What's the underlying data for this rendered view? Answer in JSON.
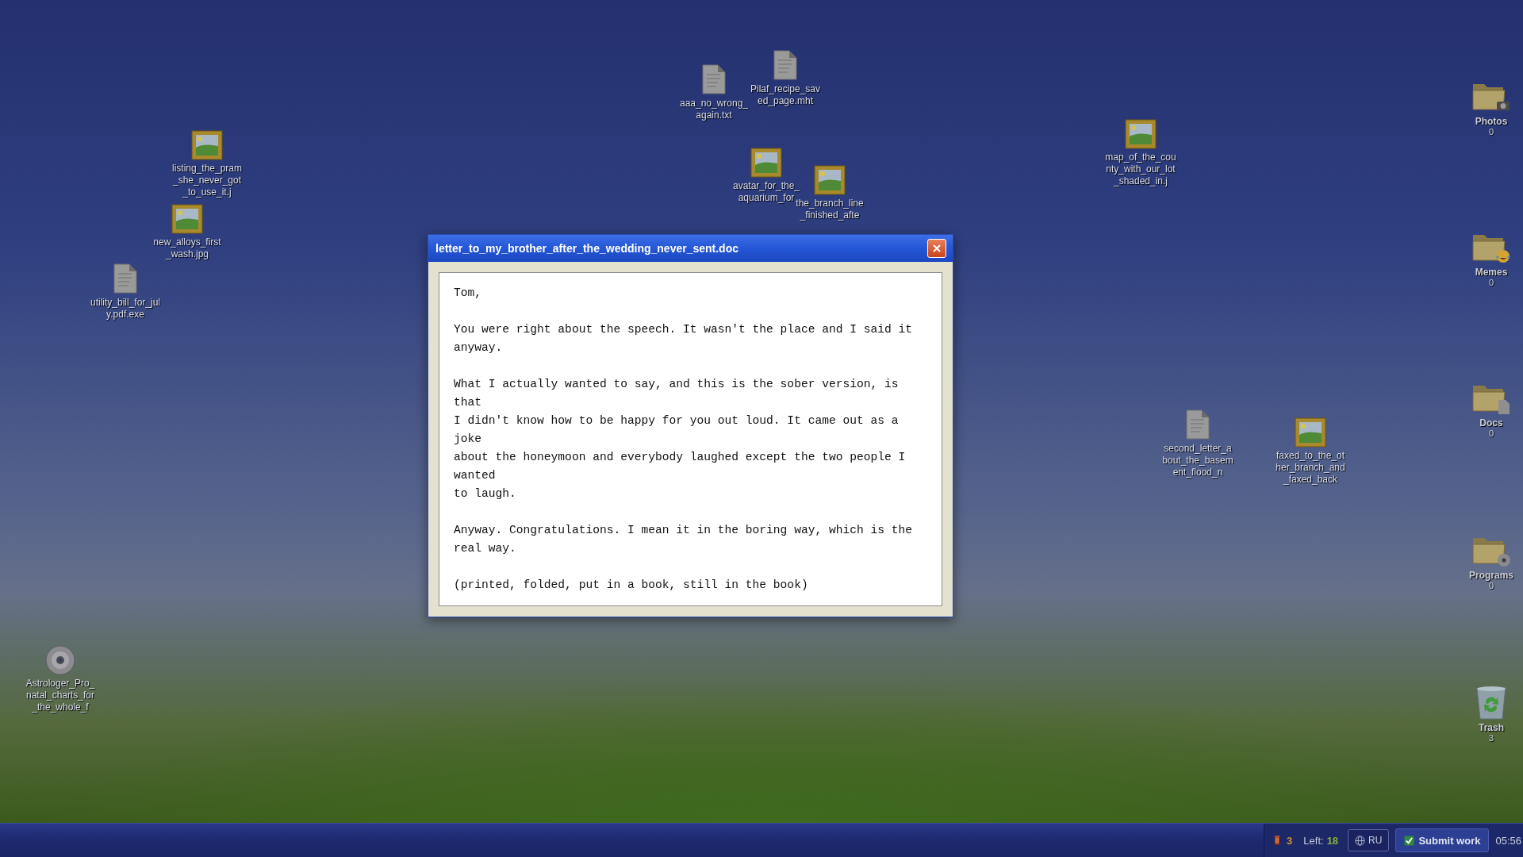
{
  "desktop": {
    "icons": [
      {
        "kind": "image",
        "label": "listing_the_pram_she_never_got_to_use_it.j"
      },
      {
        "kind": "image",
        "label": "new_alloys_first_wash.jpg"
      },
      {
        "kind": "document",
        "label": "utility_bill_for_july.pdf.exe"
      },
      {
        "kind": "disc",
        "label": "Astrologer_Pro_natal_charts_for_the_whole_f"
      },
      {
        "kind": "document",
        "label": "Pilaf_recipe_saved_page.mht"
      },
      {
        "kind": "document",
        "label": "aaa_no_wrong_again.txt"
      },
      {
        "kind": "image",
        "label": "avatar_for_the_aquarium_for"
      },
      {
        "kind": "image",
        "label": "the_branch_line_finished_afte"
      },
      {
        "kind": "image",
        "label": "map_of_the_county_with_our_lot_shaded_in.j"
      },
      {
        "kind": "document",
        "label": "second_letter_about_the_basement_flood_n"
      },
      {
        "kind": "image",
        "label": "faxed_to_the_other_branch_and_faxed_back"
      }
    ],
    "folders": [
      {
        "kind": "photos",
        "label": "Photos",
        "count": "0"
      },
      {
        "kind": "memes",
        "label": "Memes",
        "count": "0"
      },
      {
        "kind": "docs",
        "label": "Docs",
        "count": "0"
      },
      {
        "kind": "programs",
        "label": "Programs",
        "count": "0"
      },
      {
        "kind": "trash",
        "label": "Trash",
        "count": "3"
      }
    ]
  },
  "dialog": {
    "title": "letter_to_my_brother_after_the_wedding_never_sent.doc",
    "body": "Tom,\n\nYou were right about the speech. It wasn't the place and I said it anyway.\n\nWhat I actually wanted to say, and this is the sober version, is that\nI didn't know how to be happy for you out loud. It came out as a joke\nabout the honeymoon and everybody laughed except the two people I wanted\nto laugh.\n\nAnyway. Congratulations. I mean it in the boring way, which is the real way.\n\n(printed, folded, put in a book, still in the book)"
  },
  "taskbar": {
    "counter": "3",
    "left_label": "Left:",
    "left_value": "18",
    "language": "RU",
    "submit": "Submit work",
    "clock": "05:56"
  }
}
